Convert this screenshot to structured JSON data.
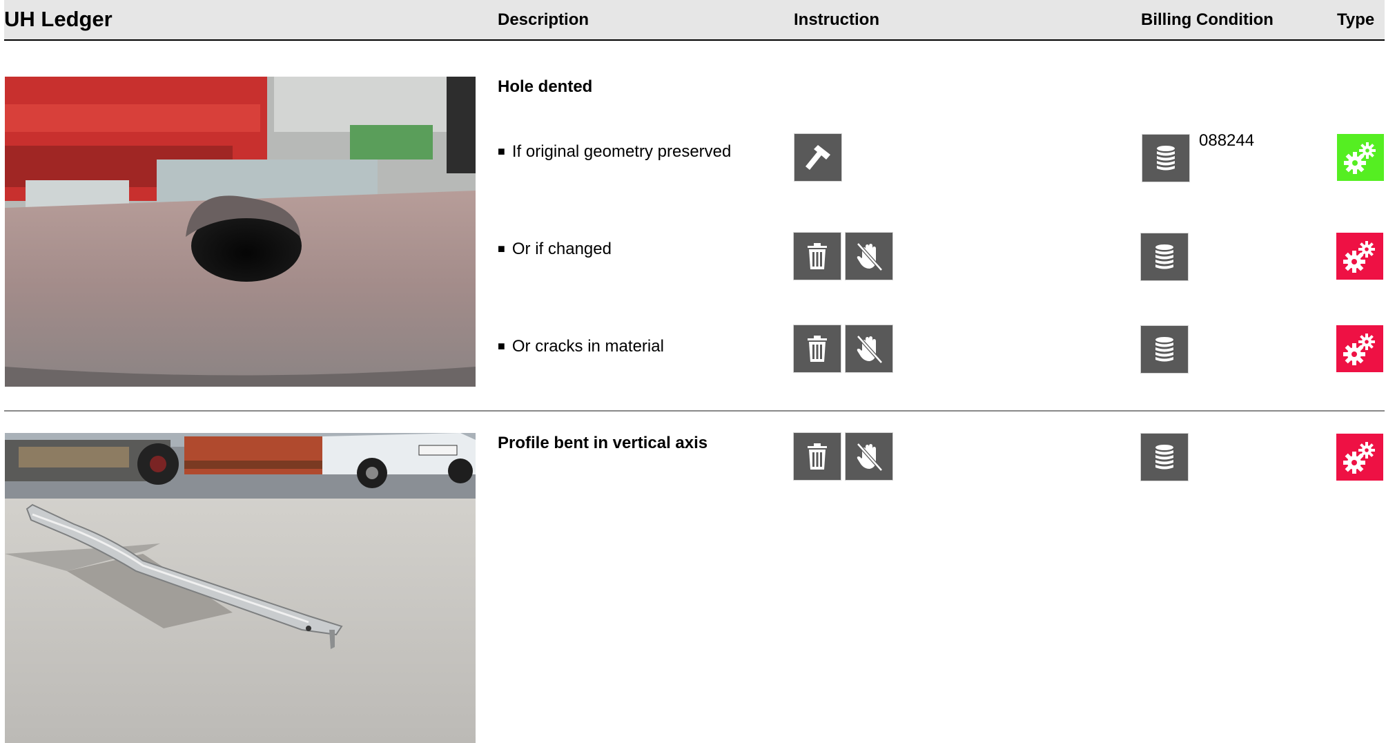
{
  "header": {
    "title": "UH Ledger",
    "columns": {
      "description": "Description",
      "instruction": "Instruction",
      "billing": "Billing Condition",
      "type": "Type"
    }
  },
  "colors": {
    "icon_bg": "#595959",
    "type_ok": "#55ee22",
    "type_bad": "#ee1144",
    "header_bg": "#e6e6e6"
  },
  "sections": [
    {
      "heading": "Hole dented",
      "photo_description_icon": "photo-hole-dented",
      "rows": [
        {
          "text": "If original geometry preserved",
          "instruction_icons": [
            "hammer-icon"
          ],
          "billing_icon": "coin-stack-icon",
          "billing_code": "088244",
          "type": "ok"
        },
        {
          "text": "Or if changed",
          "instruction_icons": [
            "trash-icon",
            "no-hand-icon"
          ],
          "billing_icon": "coin-stack-icon",
          "billing_code": "",
          "type": "bad"
        },
        {
          "text": "Or cracks in material",
          "instruction_icons": [
            "trash-icon",
            "no-hand-icon"
          ],
          "billing_icon": "coin-stack-icon",
          "billing_code": "",
          "type": "bad"
        }
      ]
    },
    {
      "heading": "Profile bent in vertical axis",
      "photo_description_icon": "photo-profile-bent",
      "rows": [
        {
          "text": "",
          "instruction_icons": [
            "trash-icon",
            "no-hand-icon"
          ],
          "billing_icon": "coin-stack-icon",
          "billing_code": "",
          "type": "bad"
        }
      ]
    }
  ]
}
